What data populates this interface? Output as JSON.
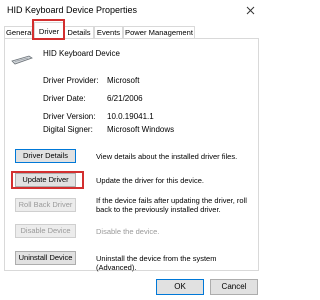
{
  "window": {
    "title": "HID Keyboard Device Properties",
    "close_glyph": "×"
  },
  "tabs": [
    {
      "label": "General"
    },
    {
      "label": "Driver",
      "selected": true
    },
    {
      "label": "Details"
    },
    {
      "label": "Events"
    },
    {
      "label": "Power Management"
    }
  ],
  "device": {
    "name": "HID Keyboard Device",
    "icon": "keyboard-icon"
  },
  "info": {
    "provider_label": "Driver Provider:",
    "provider_value": "Microsoft",
    "date_label": "Driver Date:",
    "date_value": "6/21/2006",
    "version_label": "Driver Version:",
    "version_value": "10.0.19041.1",
    "signer_label": "Digital Signer:",
    "signer_value": "Microsoft Windows"
  },
  "actions": {
    "details_label": "Driver Details",
    "details_desc": "View details about the installed driver files.",
    "update_label": "Update Driver",
    "update_desc": "Update the driver for this device.",
    "rollback_label": "Roll Back Driver",
    "rollback_desc": "If the device fails after updating the driver, roll back to the previously installed driver.",
    "disable_label": "Disable Device",
    "disable_desc": "Disable the device.",
    "uninstall_label": "Uninstall Device",
    "uninstall_desc": "Uninstall the device from the system (Advanced)."
  },
  "footer": {
    "ok_label": "OK",
    "cancel_label": "Cancel"
  },
  "colors": {
    "highlight": "#d32f2f",
    "default_button_border": "#0078d7"
  }
}
